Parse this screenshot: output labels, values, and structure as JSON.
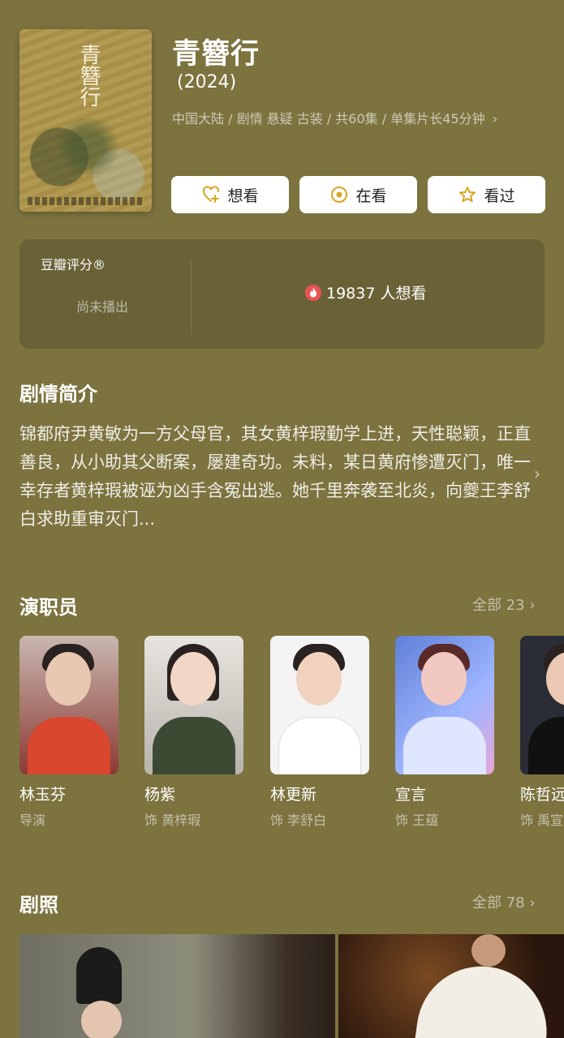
{
  "header": {
    "title": "青簪行",
    "year": "(2024)",
    "meta": "中国大陆 / 剧情 悬疑 古装 / 共60集 / 单集片长45分钟",
    "poster_title": "青簪行"
  },
  "actions": [
    {
      "label": "想看",
      "icon": "heart-plus-icon"
    },
    {
      "label": "在看",
      "icon": "circle-dot-icon"
    },
    {
      "label": "看过",
      "icon": "star-icon"
    }
  ],
  "rating": {
    "label": "豆瓣评分®",
    "status": "尚未播出",
    "want_count": "19837 人想看"
  },
  "synopsis": {
    "title": "剧情简介",
    "text": "锦都府尹黄敏为一方父母官，其女黄梓瑕勤学上进，天性聪颖，正直善良，从小助其父断案，屡建奇功。未料，某日黄府惨遭灭门，唯一幸存者黄梓瑕被诬为凶手含冤出逃。她千里奔袭至北炎，向夔王李舒白求助重审灭门..."
  },
  "cast": {
    "title": "演职员",
    "more": "全部 23",
    "members": [
      {
        "name": "林玉芬",
        "role": "导演"
      },
      {
        "name": "杨紫",
        "role": "饰 黄梓瑕"
      },
      {
        "name": "林更新",
        "role": "饰 李舒白"
      },
      {
        "name": "宣言",
        "role": "饰 王蕴"
      },
      {
        "name": "陈哲远",
        "role": "饰 禹宣"
      }
    ]
  },
  "stills": {
    "title": "剧照",
    "more": "全部 78"
  },
  "colors": {
    "background": "#7c733f",
    "card": "#6a6237",
    "accent_icon": "#d9a520",
    "flame": "#e95454"
  }
}
